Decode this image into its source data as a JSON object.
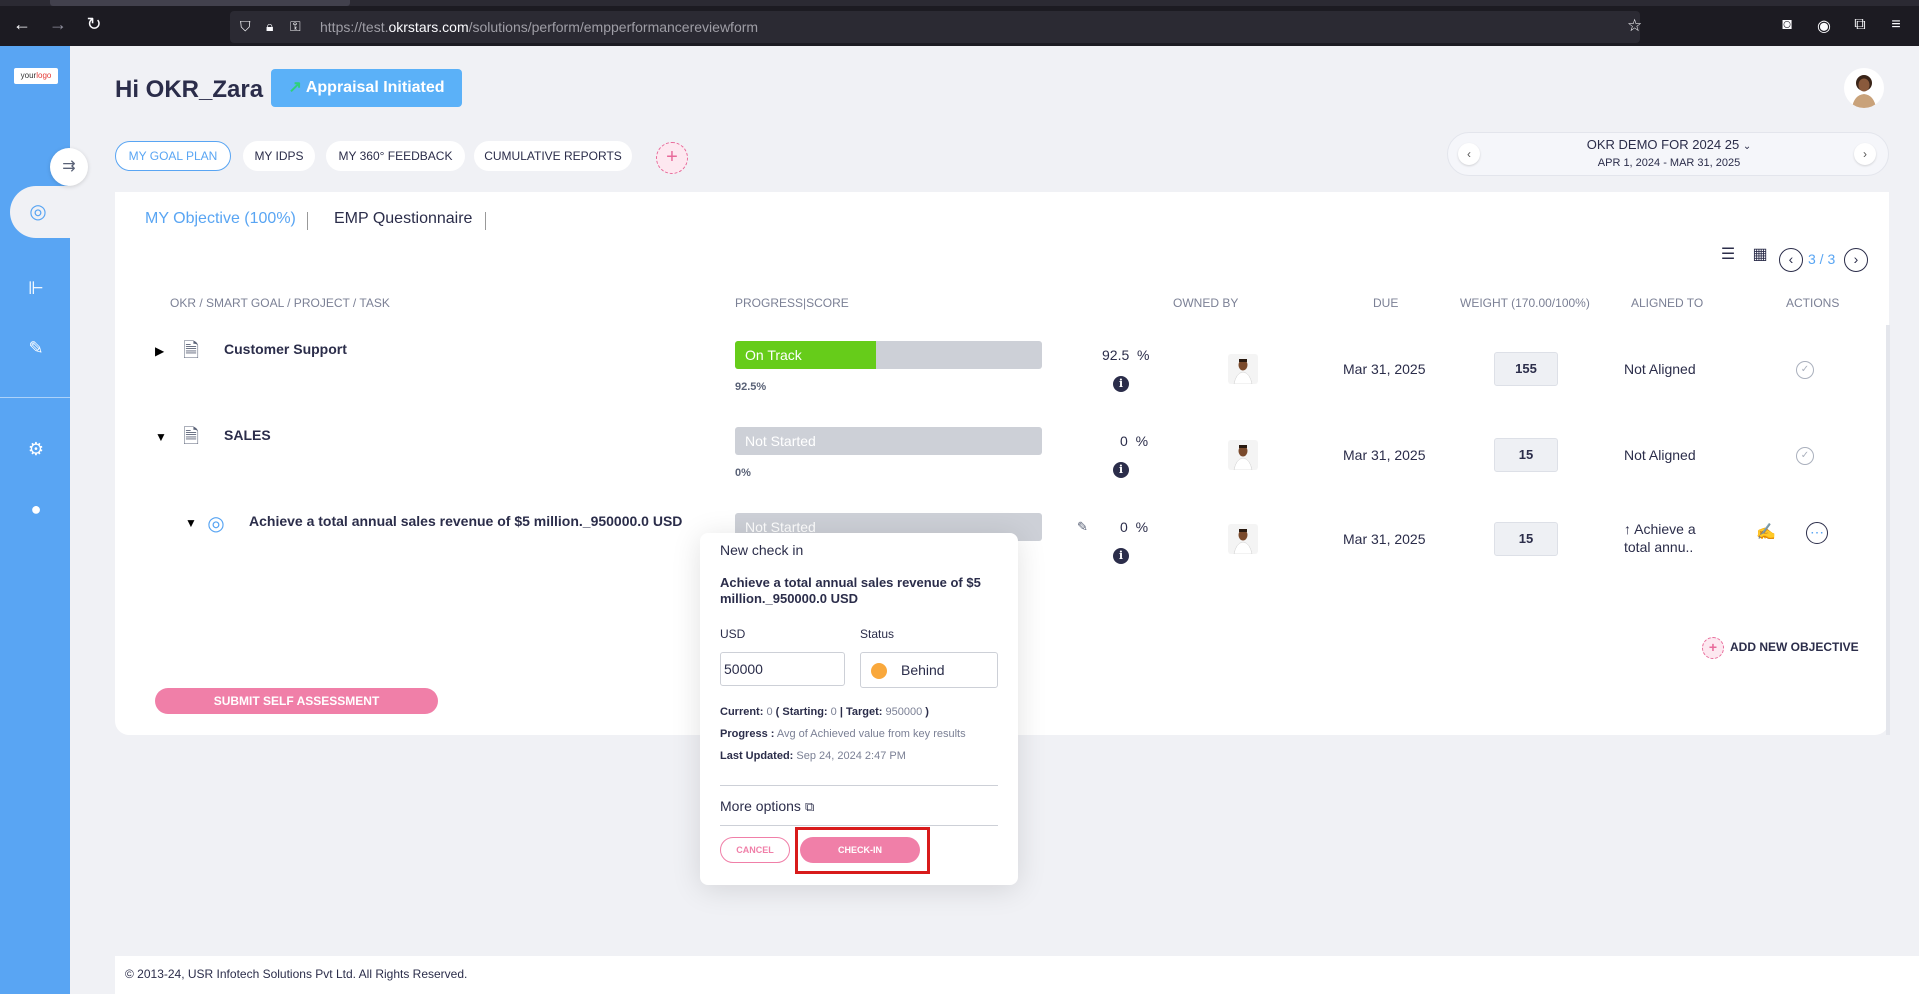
{
  "browser": {
    "url_prefix": "https://test.",
    "url_host": "okrstars.com",
    "url_path": "/solutions/perform/empperformancereviewform"
  },
  "sidebar": {
    "logo_text_1": "your",
    "logo_text_2": "logo",
    "items": [
      {
        "icon": "target-icon",
        "active": true
      },
      {
        "icon": "hierarchy-icon",
        "active": false
      },
      {
        "icon": "document-edit-icon",
        "active": false
      },
      {
        "icon": "gear-icon",
        "active": false
      },
      {
        "icon": "user-icon",
        "active": false
      }
    ]
  },
  "header": {
    "greeting": "Hi OKR_Zara",
    "appraisal_label": "Appraisal Initiated"
  },
  "tabs": [
    {
      "label": "MY GOAL PLAN",
      "active": true
    },
    {
      "label": "MY IDPS",
      "active": false
    },
    {
      "label": "MY 360° FEEDBACK",
      "active": false
    },
    {
      "label": "CUMULATIVE REPORTS",
      "active": false
    }
  ],
  "period": {
    "title": "OKR DEMO FOR 2024 25",
    "dates": "APR 1, 2024 - MAR 31, 2025"
  },
  "subtabs": {
    "objective": "MY Objective (100%)",
    "questionnaire": "EMP Questionnaire"
  },
  "pagination": "3 / 3",
  "columns": {
    "okr": "OKR / SMART GOAL / PROJECT / TASK",
    "progress": "PROGRESS|SCORE",
    "owned_by": "OWNED BY",
    "due": "DUE",
    "weight": "WEIGHT (170.00/100%)",
    "aligned_to": "ALIGNED TO",
    "actions": "ACTIONS"
  },
  "rows": [
    {
      "title": "Customer Support",
      "status": "On Track",
      "progress": 0.46,
      "sub_pct": "92.5%",
      "score": "92.5",
      "pct_sign": "%",
      "due": "Mar 31, 2025",
      "weight": "155",
      "aligned": "Not Aligned",
      "status_color": "#66cc1a"
    },
    {
      "title": "SALES",
      "status": "Not Started",
      "progress": 0,
      "sub_pct": "0%",
      "score": "0",
      "pct_sign": "%",
      "due": "Mar 31, 2025",
      "weight": "15",
      "aligned": "Not Aligned",
      "status_color": "#cdd0d7"
    },
    {
      "title": "Achieve a total annual sales revenue of $5 million._950000.0 USD",
      "status": "Not Started",
      "progress": 0,
      "score": "0",
      "pct_sign": "%",
      "due": "Mar 31, 2025",
      "weight": "15",
      "aligned_line1": "↑ Achieve a",
      "aligned_line2": "total annu.."
    }
  ],
  "add_objective": "ADD NEW OBJECTIVE",
  "submit_label": "SUBMIT SELF ASSESSMENT",
  "modal": {
    "title": "New check in",
    "objective": "Achieve a total annual sales revenue of $5 million._950000.0 USD",
    "usd_label": "USD",
    "usd_value": "50000",
    "status_label": "Status",
    "status_value": "Behind",
    "status_color": "#f9a83c",
    "current_label": "Current:",
    "current_value": "0",
    "starting_label": "( Starting:",
    "starting_value": "0",
    "target_label": "| Target:",
    "target_value": "950000",
    "target_close": ")",
    "progress_label": "Progress :",
    "progress_value": "Avg of Achieved value from key results",
    "updated_label": "Last Updated:",
    "updated_value": "Sep 24, 2024 2:47 PM",
    "more_options": "More options",
    "cancel": "CANCEL",
    "checkin": "CHECK-IN"
  },
  "footer": "© 2013-24, USR Infotech Solutions Pvt Ltd. All Rights Reserved."
}
